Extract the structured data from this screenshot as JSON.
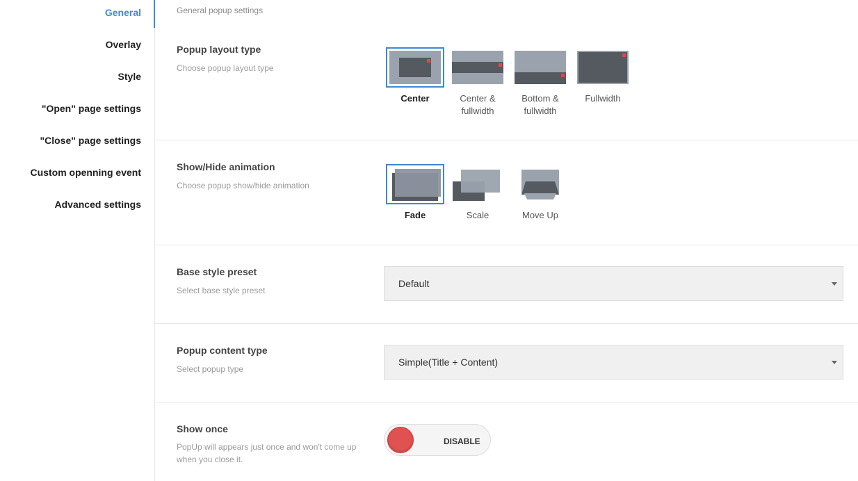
{
  "colors": {
    "accent": "#3a8ad6",
    "thumb_bg": "#9aa3ad",
    "thumb_dark": "#555a60",
    "marker_red": "#e04848",
    "toggle_off": "#e05252"
  },
  "sidebar": {
    "items": [
      {
        "label": "General",
        "active": true
      },
      {
        "label": "Overlay",
        "active": false
      },
      {
        "label": "Style",
        "active": false
      },
      {
        "label": "\"Open\" page settings",
        "active": false
      },
      {
        "label": "\"Close\" page settings",
        "active": false
      },
      {
        "label": "Custom openning event",
        "active": false
      },
      {
        "label": "Advanced settings",
        "active": false
      }
    ]
  },
  "main": {
    "section_description": "General popup settings",
    "layout_type": {
      "title": "Popup layout type",
      "description": "Choose popup layout type",
      "selected": "Center",
      "options": [
        {
          "label": "Center",
          "icon": "layout-center-icon"
        },
        {
          "label": "Center & fullwidth",
          "icon": "layout-center-fullwidth-icon"
        },
        {
          "label": "Bottom & fullwidth",
          "icon": "layout-bottom-fullwidth-icon"
        },
        {
          "label": "Fullwidth",
          "icon": "layout-fullwidth-icon"
        }
      ]
    },
    "animation": {
      "title": "Show/Hide animation",
      "description": "Choose popup show/hide animation",
      "selected": "Fade",
      "options": [
        {
          "label": "Fade",
          "icon": "animation-fade-icon"
        },
        {
          "label": "Scale",
          "icon": "animation-scale-icon"
        },
        {
          "label": "Move Up",
          "icon": "animation-move-up-icon"
        }
      ]
    },
    "base_style": {
      "title": "Base style preset",
      "description": "Select base style preset",
      "value": "Default"
    },
    "content_type": {
      "title": "Popup content type",
      "description": "Select popup type",
      "value": "Simple(Title + Content)"
    },
    "show_once": {
      "title": "Show once",
      "description": "PopUp will appears just once and won't come up when you close it.",
      "toggle_label": "DISABLE",
      "enabled": false
    }
  }
}
